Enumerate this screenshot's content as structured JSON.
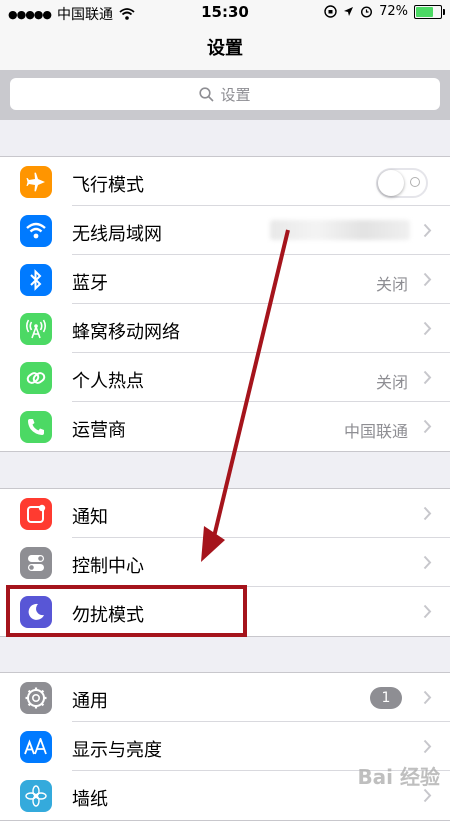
{
  "status_bar": {
    "carrier": "中国联通",
    "time": "15:30",
    "battery": "72%",
    "battery_level": 0.72
  },
  "nav": {
    "title": "设置"
  },
  "search": {
    "placeholder": "设置"
  },
  "groups": [
    {
      "rows": [
        {
          "label": "飞行模式",
          "icon": "airplane-icon",
          "color": "#ff9500",
          "accessory": "toggle",
          "toggle_on": false
        },
        {
          "label": "无线局域网",
          "icon": "wifi-icon",
          "color": "#007aff",
          "value": "",
          "blurred_value": true
        },
        {
          "label": "蓝牙",
          "icon": "bluetooth-icon",
          "color": "#007aff",
          "value": "关闭"
        },
        {
          "label": "蜂窝移动网络",
          "icon": "cellular-antenna-icon",
          "color": "#4cd964",
          "value": ""
        },
        {
          "label": "个人热点",
          "icon": "hotspot-chain-icon",
          "color": "#4cd964",
          "value": "关闭"
        },
        {
          "label": "运营商",
          "icon": "phone-icon",
          "color": "#4cd964",
          "value": "中国联通"
        }
      ]
    },
    {
      "rows": [
        {
          "label": "通知",
          "icon": "notification-icon",
          "color": "#ff3b30"
        },
        {
          "label": "控制中心",
          "icon": "control-center-icon",
          "color": "#8e8e93"
        },
        {
          "label": "勿扰模式",
          "icon": "moon-icon",
          "color": "#5856d6"
        }
      ]
    },
    {
      "rows": [
        {
          "label": "通用",
          "icon": "gear-icon",
          "color": "#8e8e93",
          "badge": "1"
        },
        {
          "label": "显示与亮度",
          "icon": "display-aa-icon",
          "color": "#007aff"
        },
        {
          "label": "墙纸",
          "icon": "wallpaper-flower-icon",
          "color": "#34aadc"
        }
      ]
    }
  ],
  "annotation": {
    "arrow_color": "#a5141c",
    "watermark": "Bai 经验"
  }
}
